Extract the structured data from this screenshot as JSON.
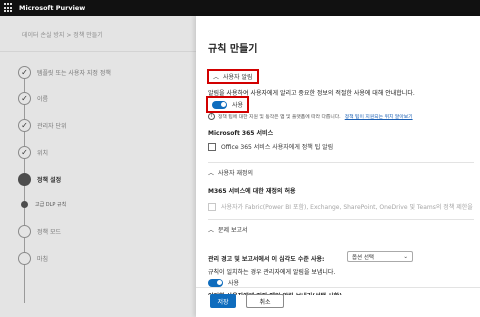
{
  "app": {
    "title": "Microsoft Purview"
  },
  "breadcrumb": {
    "text": "데이터 손실 방지  >  정책 만들기"
  },
  "steps": [
    {
      "label": "템플릿 또는 사용자 지정 정책",
      "state": "done"
    },
    {
      "label": "이름",
      "state": "done"
    },
    {
      "label": "관리자 단위",
      "state": "done"
    },
    {
      "label": "위치",
      "state": "done"
    },
    {
      "label": "정책 설정",
      "state": "current"
    },
    {
      "label": "고급 DLP 규칙",
      "state": "sub"
    },
    {
      "label": "정책 모드",
      "state": "todo"
    },
    {
      "label": "마침",
      "state": "todo"
    }
  ],
  "panel": {
    "title": "규칙 만들기",
    "user_notify": {
      "section_label": "사용자 알림",
      "description": "알림을 사용하여 사용자에게 알리고 중요한 정보의 적절한 사용에 대해 안내합니다.",
      "toggle_label": "사용",
      "info_text": "정책 팁에 대한 지원 및 동작은 앱 및 플랫폼에 따라 다릅니다.",
      "info_link": "정책 팁이 지원되는 위치 알아보기",
      "o365_heading": "Microsoft 365 서비스",
      "o365_checkbox": "Office 365 서비스 사용자에게 정책 팁 알림"
    },
    "user_override": {
      "section_label": "사용자 재정의",
      "heading": "M365 서비스에 대한 재정의 허용",
      "checkbox": "사용자가 Fabric(Power BI 포함), Exchange, SharePoint, OneDrive 및 Teams의 정책 제한을"
    },
    "incident_report": {
      "section_label": "문제 보고서",
      "severity_label": "관리 경고 및 보고서에서 이 심각도 수준 사용:",
      "severity_value": "옵션 선택",
      "alert_label": "규칙이 일치하는 경우 관리자에게 알림을 보냅니다.",
      "toggle_label": "사용",
      "email_label": "이러한 사용자에게 전자 메일 알림 보내기(선택 사항)"
    }
  },
  "footer": {
    "save_label": "저장",
    "cancel_label": "취소"
  },
  "colors": {
    "accent": "#0f6cbd",
    "highlight": "#d20000",
    "topbar": "#111111"
  },
  "icons": {
    "app_launcher": "waffle-icon",
    "check": "checkmark-icon",
    "collapse": "chevron-up-icon",
    "dropdown": "chevron-down-icon",
    "info": "info-icon"
  }
}
